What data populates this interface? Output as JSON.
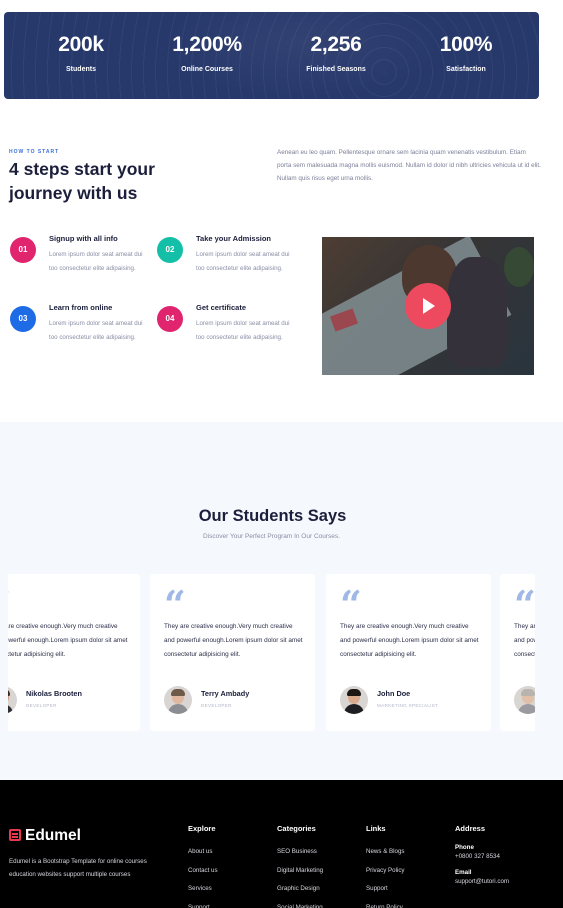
{
  "stats": [
    {
      "value": "200k",
      "label": "Students"
    },
    {
      "value": "1,200%",
      "label": "Online Courses"
    },
    {
      "value": "2,256",
      "label": "Finished Seasons"
    },
    {
      "value": "100%",
      "label": "Satisfaction"
    }
  ],
  "steps_section": {
    "eyebrow": "HOW TO START",
    "title": "4 steps start your journey with us",
    "description": "Aenean eu leo quam. Pellentesque ornare sem lacinia quam venenatis vestibulum. Etiam porta sem malesuada magna mollis euismod. Nullam id dolor id nibh ultricies vehicula ut id elit. Nullam quis risus eget urna mollis.",
    "steps": [
      {
        "number": "01",
        "title": "Signup with all info",
        "text": "Lorem ipsum dolor seat ameat dui too consectetur elite adipaising.",
        "color": "#e0246e"
      },
      {
        "number": "02",
        "title": "Take your Admission",
        "text": "Lorem ipsum dolor seat ameat dui too consectetur elite adipaising.",
        "color": "#13bfa6"
      },
      {
        "number": "03",
        "title": "Learn from online",
        "text": "Lorem ipsum dolor seat ameat dui too consectetur elite adipaising.",
        "color": "#1e6be6"
      },
      {
        "number": "04",
        "title": "Get certificate",
        "text": "Lorem ipsum dolor seat ameat dui too consectetur elite adipaising.",
        "color": "#e0246e"
      }
    ],
    "video": {
      "icon": "play-icon",
      "accent": "#ee4a5f"
    }
  },
  "testimonials": {
    "title": "Our Students Says",
    "subtitle": "Discover Your Perfect Program In Our Courses.",
    "cards": [
      {
        "text": "They are creative enough.Very much creative and powerful enough.Lorem ipsum dolor sit amet consectetur adipisicing elit.",
        "name": "Nikolas Brooten",
        "role": "DEVELOPER"
      },
      {
        "text": "They are creative enough.Very much creative and powerful enough.Lorem ipsum dolor sit amet consectetur adipisicing elit.",
        "name": "Terry Ambady",
        "role": "DEVELOPER"
      },
      {
        "text": "They are creative enough.Very much creative and powerful enough.Lorem ipsum dolor sit amet consectetur adipisicing elit.",
        "name": "John Doe",
        "role": "MARKETING SPECIALIST"
      },
      {
        "text": "They are creative enough.Very much creative and powerful enough.Lorem ipsum dolor sit amet consectetur adipisicing elit.",
        "name": "",
        "role": ""
      }
    ]
  },
  "footer": {
    "logo": "Edumel",
    "about": "Edumel is a Bootstrap Template for online courses education websites support multiple courses",
    "explore": {
      "heading": "Explore",
      "links": [
        "About us",
        "Contact us",
        "Services",
        "Support"
      ]
    },
    "categories": {
      "heading": "Categories",
      "links": [
        "SEO Business",
        "Digital Marketing",
        "Graphic Design",
        "Social Marketing"
      ]
    },
    "links": {
      "heading": "Links",
      "links": [
        "News & Blogs",
        "Privacy Policy",
        "Support",
        "Return Policy"
      ]
    },
    "address": {
      "heading": "Address",
      "phone_label": "Phone",
      "phone": "+0800 327 8534",
      "email_label": "Email",
      "email": "support@tutori.com"
    }
  }
}
